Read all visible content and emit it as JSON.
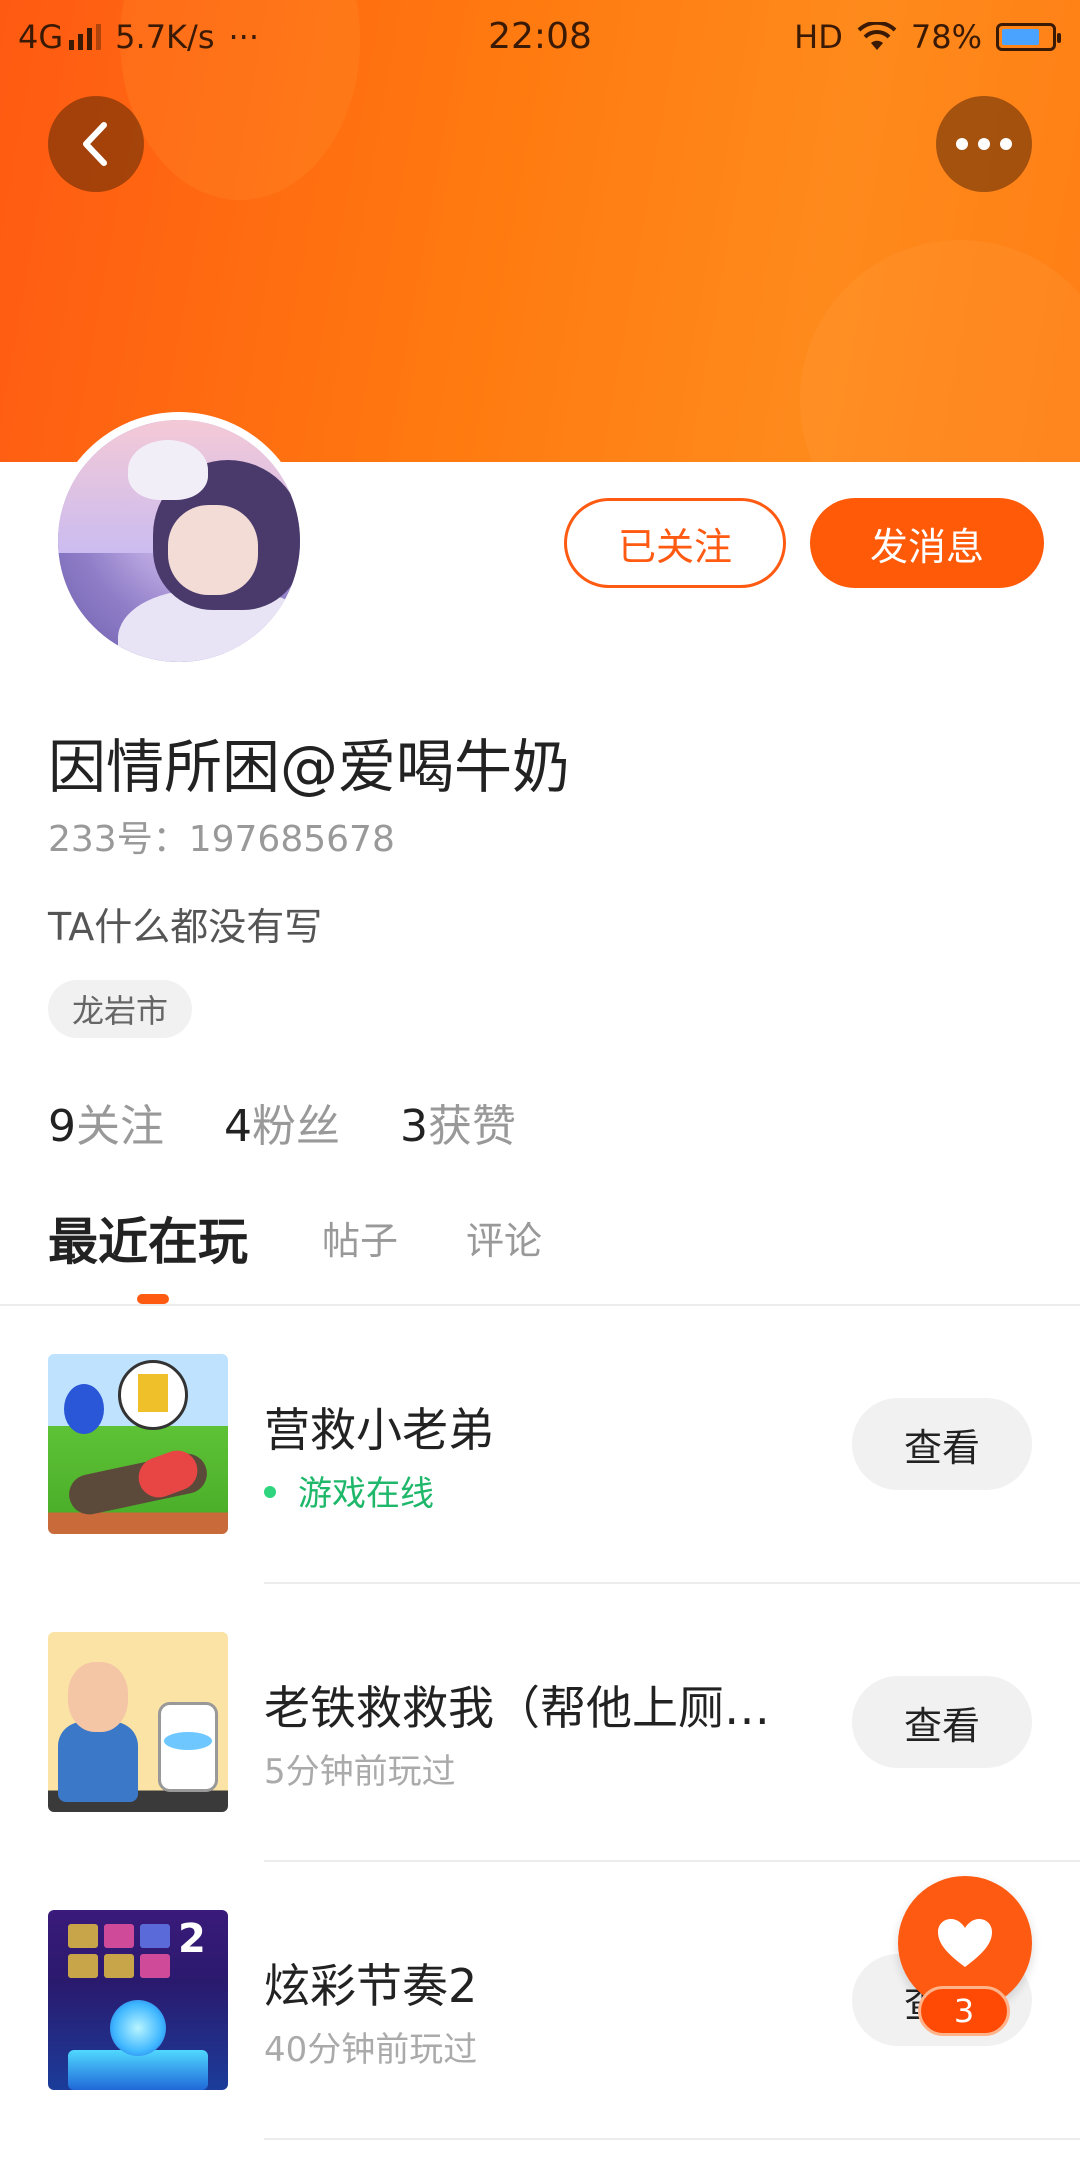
{
  "status_bar": {
    "network": "4G",
    "speed": "5.7K/s",
    "dots": "···",
    "time": "22:08",
    "hd": "HD",
    "battery": "78%",
    "battery_level": 0.78
  },
  "header": {
    "back_icon": "chevron-left-icon",
    "more_icon": "more-dots-icon",
    "colors": {
      "brand": "#ff5a12",
      "accent": "#ff7a10"
    }
  },
  "profile": {
    "follow_button_label": "已关注",
    "message_button_label": "发消息",
    "username": "因情所困@爱喝牛奶",
    "user_id": "233号：197685678",
    "bio": "TA什么都没有写",
    "location": "龙岩市",
    "stats": [
      {
        "num": "9",
        "label": "关注"
      },
      {
        "num": "4",
        "label": "粉丝"
      },
      {
        "num": "3",
        "label": "获赞"
      }
    ]
  },
  "tabs": [
    {
      "label": "最近在玩"
    },
    {
      "label": "帖子"
    },
    {
      "label": "评论"
    }
  ],
  "games": [
    {
      "title": "营救小老弟",
      "subtitle": "游戏在线",
      "online": true,
      "button": "查看"
    },
    {
      "title": "老铁救救我（帮他上厕…",
      "subtitle": "5分钟前玩过",
      "online": false,
      "button": "查看"
    },
    {
      "title": "炫彩节奏2",
      "subtitle": "40分钟前玩过",
      "online": false,
      "button": "查看"
    }
  ],
  "float_like": {
    "icon": "heart-icon",
    "count": "3"
  }
}
